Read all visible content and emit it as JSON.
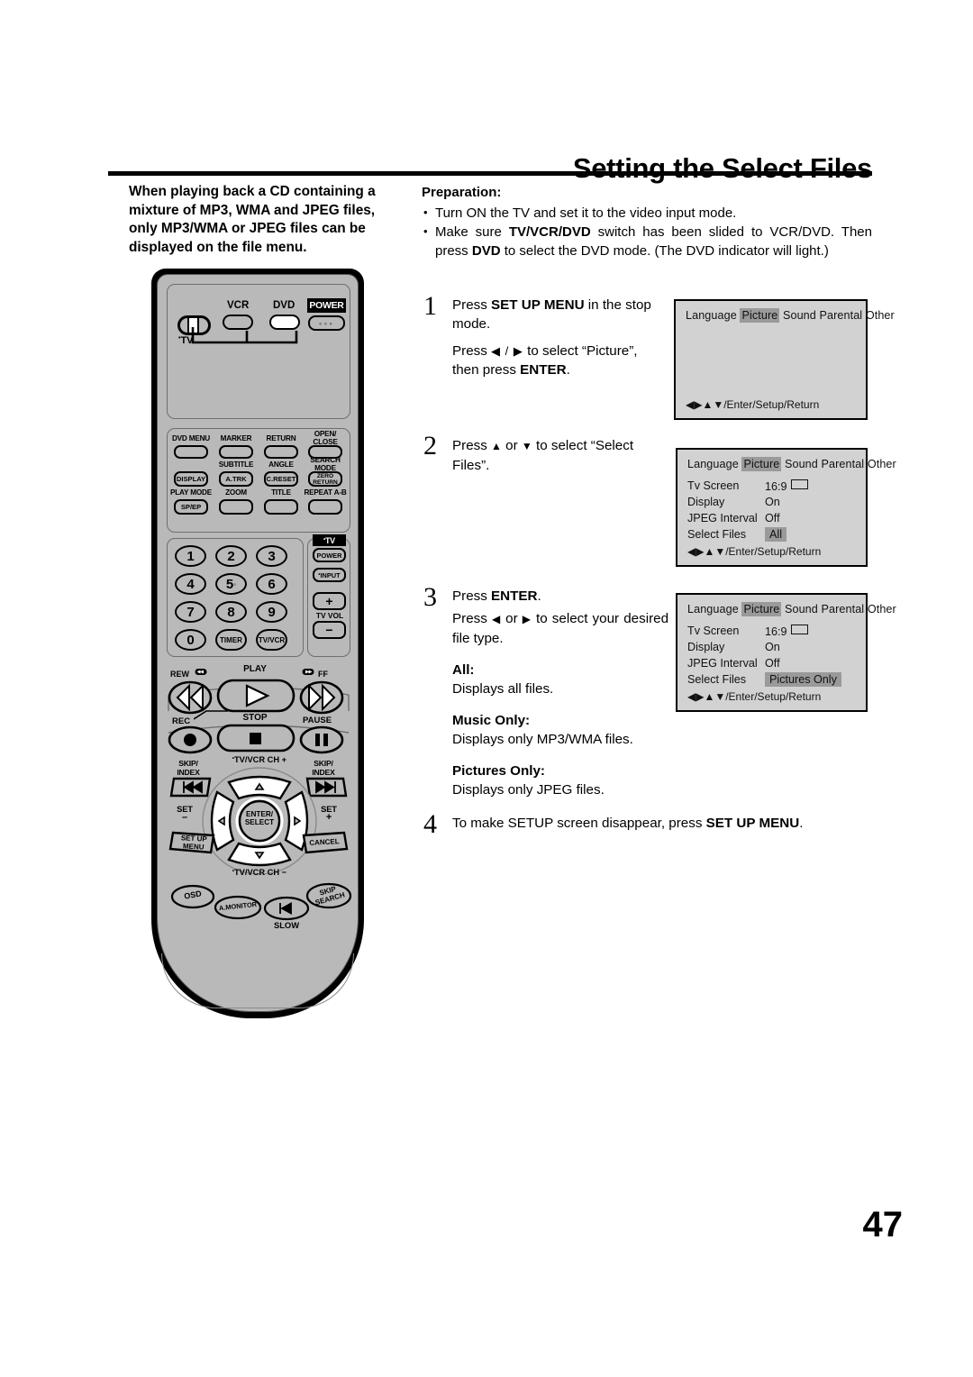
{
  "page": {
    "title": "Setting the Select Files",
    "number": "47"
  },
  "intro": {
    "text": "When playing back a CD containing a mixture of MP3, WMA and JPEG files, only MP3/WMA or JPEG files can be displayed on the file menu."
  },
  "preparation": {
    "heading": "Preparation:",
    "items": [
      "Turn ON the TV and set it to the video input mode.",
      "Make sure TV/VCR/DVD switch has been slided to VCR/DVD. Then press DVD to select the DVD mode. (The DVD indicator will light.)"
    ]
  },
  "steps": [
    {
      "number": "1",
      "line1_a": "Press ",
      "line1_b": "SET UP  MENU",
      "line1_c": " in the stop mode.",
      "line2_a": "Press ",
      "line2_arrows": "◀ / ▶",
      "line2_b": " to select “Picture”, then press ",
      "line2_c": "ENTER",
      "line2_d": "."
    },
    {
      "number": "2",
      "line1_a": "Press ",
      "up": "▲",
      "line1_b": " or ",
      "down": "▼",
      "line1_c": " to select “Select Files”."
    },
    {
      "number": "3",
      "line1_a": "Press ",
      "line1_b": "ENTER",
      "line1_c": ".",
      "line2_a": "Press ",
      "left": "◀",
      "line2_b": " or ",
      "right": "▶",
      "line2_c": " to select your desired file type.",
      "options": [
        {
          "label": "All:",
          "desc": "Displays all files."
        },
        {
          "label": "Music Only:",
          "desc": "Displays only MP3/WMA files."
        },
        {
          "label": "Pictures Only:",
          "desc": "Displays only JPEG files."
        }
      ]
    },
    {
      "number": "4",
      "line1_a": "To make SETUP screen disappear, press ",
      "line1_b": "SET UP MENU",
      "line1_c": "."
    }
  ],
  "osd": {
    "tabs": [
      "Language",
      "Picture",
      "Sound",
      "Parental",
      "Other"
    ],
    "selected_tab": "Picture",
    "footer": "◀▶▲▼/Enter/Setup/Return",
    "screens": [
      {
        "id": "screen-1",
        "rows": []
      },
      {
        "id": "screen-2",
        "rows": [
          {
            "label": "Tv Screen",
            "value": "16:9",
            "box": true,
            "highlight": false
          },
          {
            "label": "Display",
            "value": "On",
            "box": false,
            "highlight": false
          },
          {
            "label": "JPEG Interval",
            "value": "Off",
            "box": false,
            "highlight": false
          },
          {
            "label": "Select Files",
            "value": "All",
            "box": false,
            "highlight": true
          }
        ]
      },
      {
        "id": "screen-3",
        "rows": [
          {
            "label": "Tv Screen",
            "value": "16:9",
            "box": true,
            "highlight": false
          },
          {
            "label": "Display",
            "value": "On",
            "box": false,
            "highlight": false
          },
          {
            "label": "JPEG Interval",
            "value": "Off",
            "box": false,
            "highlight": false
          },
          {
            "label": "Select Files",
            "value": "Pictures Only",
            "box": false,
            "highlight": true
          }
        ]
      }
    ]
  },
  "remote": {
    "mode_switch": {
      "label": "TV",
      "vcr": "VCR",
      "dvd": "DVD"
    },
    "power": "POWER",
    "row_dvdmenu": [
      "DVD MENU",
      "MARKER",
      "RETURN",
      "OPEN/\nCLOSE"
    ],
    "labels_above_row2": [
      "",
      "SUBTITLE",
      "ANGLE",
      "SEARCH\nMODE"
    ],
    "row2": [
      "DISPLAY",
      "A.TRK",
      "C.RESET",
      "ZERO\nRETURN"
    ],
    "labels_above_row3": [
      "PLAY MODE",
      "ZOOM",
      "TITLE",
      "REPEAT A-B"
    ],
    "row3": [
      "SP/EP",
      "",
      "",
      ""
    ],
    "keypad": [
      "1",
      "2",
      "3",
      "4",
      "5",
      "6",
      "7",
      "8",
      "9",
      "0",
      "TIMER",
      "TV/VCR"
    ],
    "key5_dot": "◦",
    "tv_side": {
      "tv": "TV",
      "power": "POWER",
      "input": "INPUT",
      "vol": "TV VOL",
      "plus": "+",
      "minus": "−"
    },
    "transport": {
      "rew": "REW",
      "play": "PLAY",
      "ff": "FF",
      "rec": "REC",
      "stop": "STOP",
      "pause": "PAUSE"
    },
    "nav": {
      "ch_up": "TV/VCR CH +",
      "ch_down": "TV/VCR CH −",
      "enter": "ENTER/\nSELECT",
      "skip_index_left": "SKIP/\nINDEX",
      "skip_index_right": "SKIP/\nINDEX",
      "set_minus": "SET\n–",
      "set_plus": "SET\n+",
      "setup_menu": "SET UP\nMENU",
      "cancel": "CANCEL"
    },
    "bottom": {
      "osd": "OSD",
      "amonitor": "A.MONITOR",
      "slow": "SLOW",
      "skip_search": "SKIP\nSEARCH"
    }
  }
}
